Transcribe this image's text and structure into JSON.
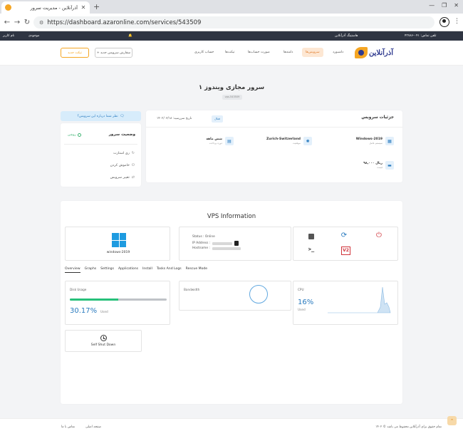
{
  "browser": {
    "tab_title": "آذرآنلاین - مدیریت سرور",
    "tab_close": "✕",
    "new_tab": "+",
    "win_min": "—",
    "win_max": "❐",
    "win_close": "✕",
    "url": "https://dashboard.azaronline.com/services/543509"
  },
  "topstrip": {
    "phone": "تلفن تماس: ۰۴۱-۴۳۷۸۶",
    "hosting": "هاستینگ آذرآنلاین",
    "user_name": "نام کاربر",
    "balance": "موجودی"
  },
  "header": {
    "logo_text": "آذرآنلاین",
    "new_ticket": "تیکت جدید",
    "order_service": "+ سفارش سرویس جدید",
    "menu": [
      "داشبورد",
      "سرویس‌ها",
      "دامنه‌ها",
      "صورت حساب‌ها",
      "تیکت‌ها",
      "حساب کاربری"
    ]
  },
  "page": {
    "title": "۱ سرور مجازی ویندوز",
    "subtitle": "vps-543509"
  },
  "status_card": {
    "help": "نظر شما درباره این سرویس؟",
    "title": "وضعیت سرور",
    "state": "روشن",
    "actions": [
      "ری استارت",
      "خاموش کردن",
      "تغییر سرویس"
    ]
  },
  "details": {
    "title": "جزئیات سرویس",
    "badge": "فعال",
    "date": "تاریخ سررسید: ۱۴۰۲/۰۳/۱۸",
    "specs": [
      {
        "value": "Windows-2019",
        "label": "سیستم عامل",
        "icon": "grid-icon"
      },
      {
        "value": "Zurich-Switzerland",
        "label": "موقعیت",
        "icon": "globe-icon"
      },
      {
        "value": "شش ماهه",
        "label": "دوره پرداخت",
        "icon": "calendar-icon"
      },
      {
        "value": "۹۸,۰۰۰ ریال",
        "label": "قیمت",
        "icon": "money-icon"
      }
    ]
  },
  "vps": {
    "title": "VPS Information",
    "os_label": "windows-2019",
    "status_line": "Status : Online",
    "ip_label": "IP Address :",
    "hostname_label": "Hostname :",
    "tabs": [
      "Overview",
      "Graphs",
      "Settings",
      "Applications",
      "Install",
      "Tasks And Logs",
      "Rescue Mode"
    ],
    "disk": {
      "title": "Disk Usage",
      "value": "30.17%",
      "unit": "Used",
      "fraction": 0.5
    },
    "bandwidth": {
      "title": "Bandwidth"
    },
    "cpu": {
      "title": "CPU",
      "value": "16%",
      "unit": "Used"
    },
    "shutdown": "Self Shut Down",
    "vs_label": "V2"
  },
  "footer": {
    "copyright": "۱۴۰۲ © تمام حقوق برای آذرآنلاین محفوظ می باشد",
    "home": "صفحه اصلی",
    "contact": "تماس با ما"
  },
  "colors": {
    "accent_orange": "#f5a623",
    "accent_blue": "#2a7bbf",
    "success_green": "#27c07a",
    "danger_red": "#d0343b"
  }
}
